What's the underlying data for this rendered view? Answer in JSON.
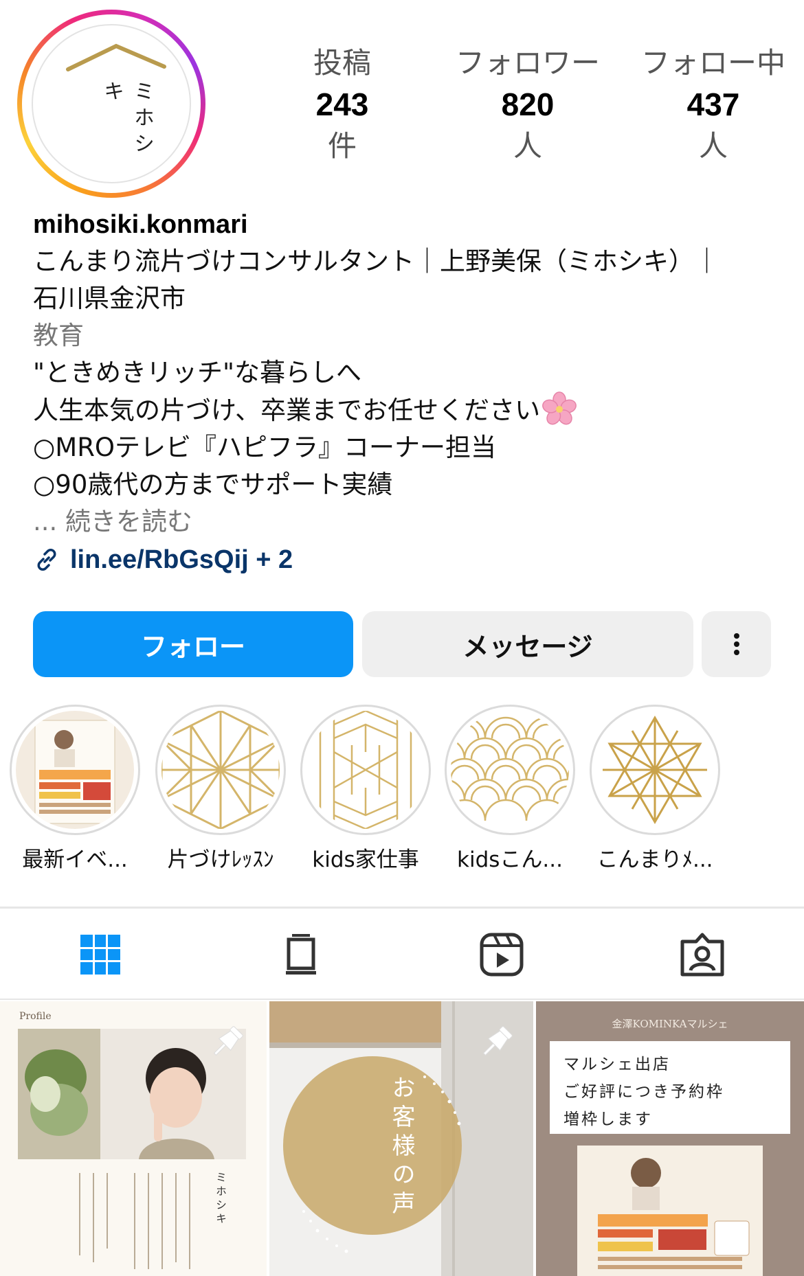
{
  "profile": {
    "avatar_text": "ミホシキ",
    "username": "mihosiki.konmari",
    "bio_line1": "こんまり流片づけコンサルタント｜上野美保（ミホシキ）｜",
    "bio_line2": "石川県金沢市",
    "category": "教育",
    "bio_line3": "\"ときめきリッチ\"な暮らしへ",
    "bio_line4": "人生本気の片づけ、卒業までお任せください",
    "bio_line5": "○MROテレビ『ハピフラ』コーナー担当",
    "bio_line6": "○90歳代の方までサポート実績",
    "more_text": "... 続きを読む",
    "link_text": "lin.ee/RbGsQij + 2"
  },
  "stats": [
    {
      "label": "投稿",
      "value": "243",
      "unit": "件"
    },
    {
      "label": "フォロワー",
      "value": "820",
      "unit": "人"
    },
    {
      "label": "フォロー中",
      "value": "437",
      "unit": "人"
    }
  ],
  "actions": {
    "follow": "フォロー",
    "message": "メッセージ",
    "more": "⋮"
  },
  "highlights": [
    {
      "label": "最新イベ..."
    },
    {
      "label": "片づけﾚｯｽﾝ"
    },
    {
      "label": "kids家仕事"
    },
    {
      "label": "kidsこん..."
    },
    {
      "label": "こんまりﾒ..."
    }
  ],
  "tabs": [
    "grid-icon",
    "feed-icon",
    "reels-icon",
    "tagged-icon"
  ],
  "posts": {
    "post1": {
      "corner_label": "Profile",
      "side_text": "ミホシキ"
    },
    "post2": {
      "title": "お客様の声"
    },
    "post3": {
      "header": "金澤KOMINKAマルシェ",
      "line1": "マルシェ出店",
      "line2": "ご好評につき予約枠",
      "line3": "増枠します"
    }
  },
  "colors": {
    "follow_button": "#0b95f7",
    "link": "#0a3569",
    "gold": "#c9a95a",
    "active_tab": "#0b95f7"
  }
}
